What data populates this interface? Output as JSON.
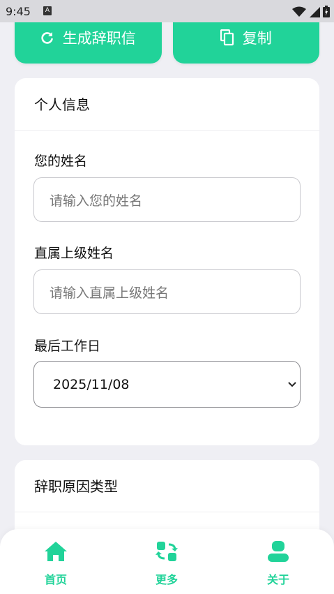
{
  "status_bar": {
    "time": "9:45",
    "notification_icon": "A"
  },
  "toolbar": {
    "generate_label": "生成辞职信",
    "copy_label": "复制"
  },
  "personal_info": {
    "title": "个人信息",
    "name_label": "您的姓名",
    "name_placeholder": "请输入您的姓名",
    "supervisor_label": "直属上级姓名",
    "supervisor_placeholder": "请输入直属上级姓名",
    "last_day_label": "最后工作日",
    "last_day_value": "2025/11/08"
  },
  "reason_section": {
    "title": "辞职原因类型"
  },
  "bottom_nav": {
    "items": [
      {
        "label": "首页",
        "icon": "home-icon"
      },
      {
        "label": "更多",
        "icon": "swap-icon"
      },
      {
        "label": "关于",
        "icon": "person-icon"
      }
    ]
  },
  "colors": {
    "accent": "#21d399",
    "background": "#efeff4",
    "card": "#ffffff"
  }
}
